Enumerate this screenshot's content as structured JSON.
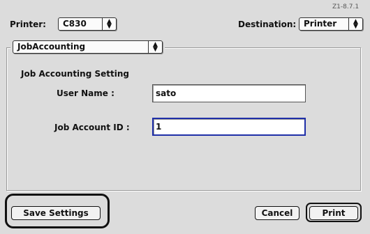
{
  "version": "Z1-8.7.1",
  "printer": {
    "label": "Printer:",
    "value": "C830"
  },
  "destination": {
    "label": "Destination:",
    "value": "Printer"
  },
  "panel": {
    "value": "JobAccounting"
  },
  "section_title": "Job Accounting Setting",
  "fields": {
    "username": {
      "label": "User Name :",
      "value": "sato"
    },
    "account_id": {
      "label": "Job Account ID :",
      "value": "1"
    }
  },
  "buttons": {
    "save": "Save Settings",
    "cancel": "Cancel",
    "print": "Print"
  },
  "icons": {
    "popup_arrow": "up-down-arrows-icon"
  }
}
